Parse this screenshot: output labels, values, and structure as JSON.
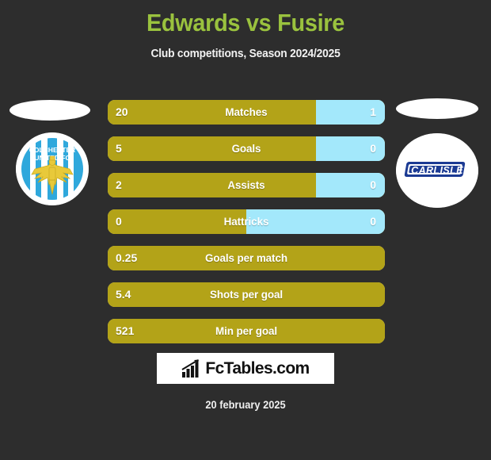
{
  "header": {
    "title": "Edwards vs Fusire",
    "subtitle": "Club competitions, Season 2024/2025",
    "title_color": "#9ac23e"
  },
  "teams": {
    "left": {
      "name": "Colchester United FC",
      "badge_name": "colchester-united-badge",
      "badge_line1": "COLCHESTER",
      "badge_line2": "UNITED FC",
      "color": "#b3a318"
    },
    "right": {
      "name": "Carlisle",
      "badge_name": "carlisle-badge",
      "badge_text": "CARLISLE",
      "color": "#a3e8fb"
    }
  },
  "chart_data": {
    "type": "bar",
    "title": "Edwards vs Fusire",
    "subtitle": "Club competitions, Season 2024/2025",
    "orientation": "horizontal-diverging",
    "series": [
      {
        "name": "Edwards",
        "color": "#b3a318"
      },
      {
        "name": "Fusire",
        "color": "#a3e8fb"
      }
    ],
    "categories": [
      "Matches",
      "Goals",
      "Assists",
      "Hattricks",
      "Goals per match",
      "Shots per goal",
      "Min per goal"
    ],
    "rows": [
      {
        "label": "Matches",
        "left": "20",
        "right": "1",
        "left_pct": 75,
        "has_right": true
      },
      {
        "label": "Goals",
        "left": "5",
        "right": "0",
        "left_pct": 75,
        "has_right": true
      },
      {
        "label": "Assists",
        "left": "2",
        "right": "0",
        "left_pct": 75,
        "has_right": true
      },
      {
        "label": "Hattricks",
        "left": "0",
        "right": "0",
        "left_pct": 50,
        "has_right": true
      },
      {
        "label": "Goals per match",
        "left": "0.25",
        "right": "",
        "left_pct": 100,
        "has_right": false
      },
      {
        "label": "Shots per goal",
        "left": "5.4",
        "right": "",
        "left_pct": 100,
        "has_right": false
      },
      {
        "label": "Min per goal",
        "left": "521",
        "right": "",
        "left_pct": 100,
        "has_right": false
      }
    ],
    "grid": false,
    "legend": "none"
  },
  "footer": {
    "brand": "FcTables.com",
    "brand_icon": "bar-chart-icon",
    "date": "20 february 2025"
  }
}
